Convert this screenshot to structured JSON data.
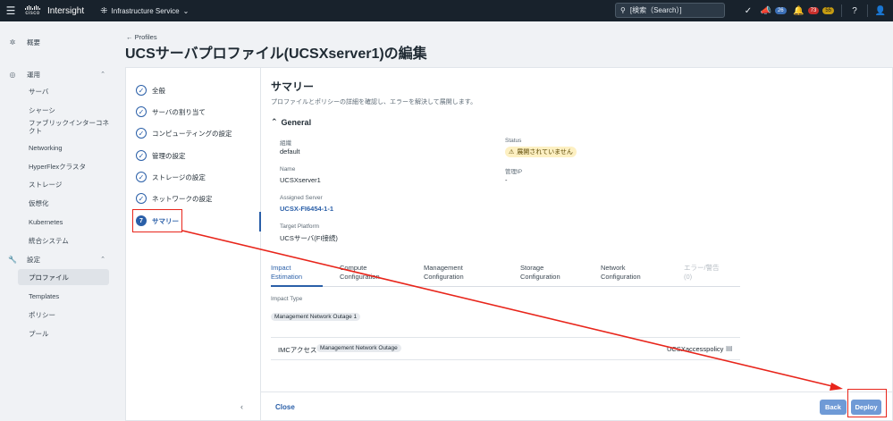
{
  "topbar": {
    "brand_word": "cisco",
    "app_name": "Intersight",
    "service": "Infrastructure Service",
    "search_placeholder": "[検索（Search）]",
    "counts": {
      "notifications": "26",
      "alarms_critical": "73",
      "alarms_warning": "55"
    },
    "colors": {
      "bar": "#18222c",
      "critical": "#c9302c",
      "warning": "#c49b12",
      "info": "#3b6fb6"
    }
  },
  "nav": {
    "overview": "概要",
    "operate_group": "運用",
    "operate_items": [
      "サーバ",
      "シャーシ",
      "ファブリックインターコネクト",
      "Networking",
      "HyperFlexクラスタ",
      "ストレージ",
      "仮想化",
      "Kubernetes",
      "統合システム"
    ],
    "configure_group": "設定",
    "configure_items": [
      "プロファイル",
      "Templates",
      "ポリシー",
      "プール"
    ]
  },
  "page": {
    "back_link": "Profiles",
    "title": "UCSサーバプロファイル(UCSXserver1)の編集"
  },
  "steps": [
    {
      "label": "全般",
      "state": "done"
    },
    {
      "label": "サーバの割り当て",
      "state": "done"
    },
    {
      "label": "コンピューティングの設定",
      "state": "done"
    },
    {
      "label": "管理の設定",
      "state": "done"
    },
    {
      "label": "ストレージの設定",
      "state": "done"
    },
    {
      "label": "ネットワークの設定",
      "state": "done"
    },
    {
      "label": "サマリー",
      "state": "current",
      "number": "7"
    }
  ],
  "summary": {
    "title": "サマリー",
    "description": "プロファイルとポリシーの詳細を確認し、エラーを解決して展開します。",
    "section": "General",
    "fields": {
      "org_label": "組織",
      "org_value": "default",
      "status_label": "Status",
      "status_value": "展開されていません",
      "name_label": "Name",
      "name_value": "UCSXserver1",
      "mgmt_ip_label": "管理IP",
      "mgmt_ip_value": "-",
      "assigned_label": "Assigned Server",
      "assigned_value": "UCSX-FI6454-1-1",
      "platform_label": "Target Platform",
      "platform_value": "UCSサーバ(FI接続)"
    },
    "tabs": [
      {
        "line1": "Impact",
        "line2": "Estimation",
        "state": "active"
      },
      {
        "line1": "Compute",
        "line2": "Configuration",
        "state": "normal"
      },
      {
        "line1": "Management",
        "line2": "Configuration",
        "state": "normal"
      },
      {
        "line1": "Storage",
        "line2": "Configuration",
        "state": "normal"
      },
      {
        "line1": "Network",
        "line2": "Configuration",
        "state": "normal"
      },
      {
        "line1": "エラー/警告",
        "line2": "(0)",
        "state": "disabled"
      }
    ],
    "impact_type_label": "Impact Type",
    "impact_type_chip": "Management Network Outage 1",
    "row": {
      "item": "IMCアクセス",
      "chip": "Management Network Outage",
      "policy": "UCSXaccesspolicy"
    }
  },
  "footer": {
    "close": "Close",
    "back": "Back",
    "deploy": "Deploy"
  },
  "annotation_color": "#e8251b"
}
